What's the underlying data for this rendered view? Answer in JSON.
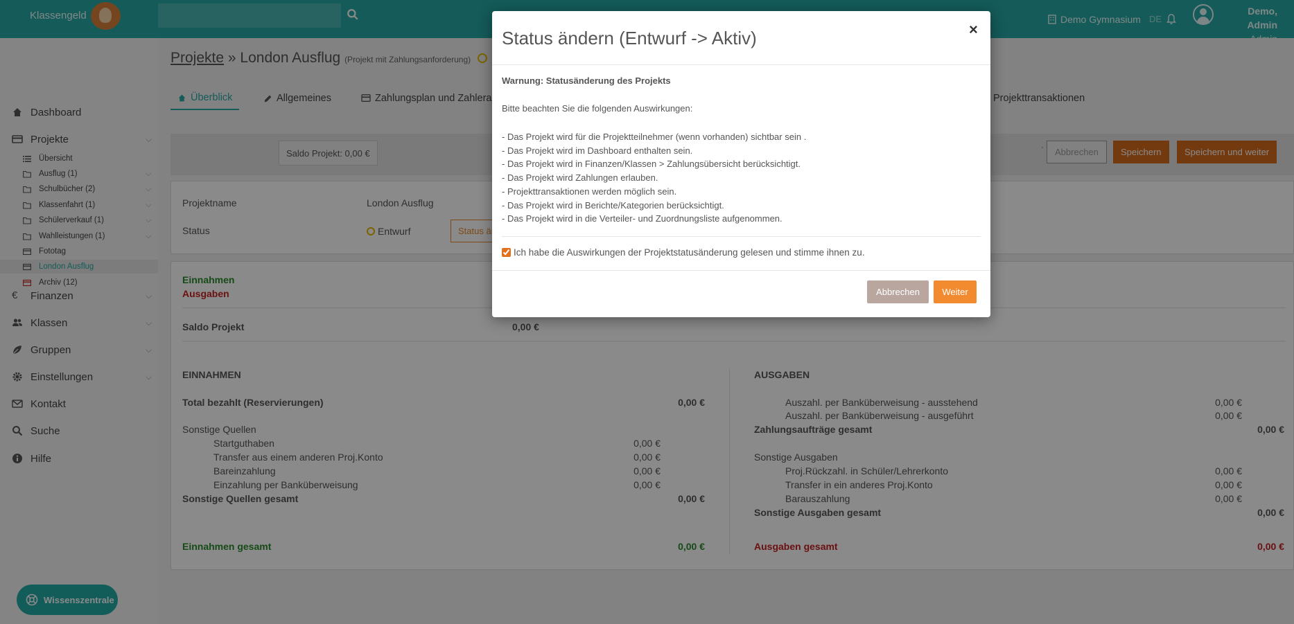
{
  "app": {
    "logo_text": "Klassengeld",
    "school": "Demo Gymnasium",
    "language": "DE",
    "user_name": "Demo, Admin",
    "user_role": "Admin Schule"
  },
  "sidebar": {
    "items": [
      {
        "label": "Dashboard",
        "icon": "home-icon",
        "chevron": false
      },
      {
        "label": "Projekte",
        "icon": "card-icon",
        "chevron": true
      },
      {
        "label": "Finanzen",
        "icon": "euro-icon",
        "chevron": true
      },
      {
        "label": "Klassen",
        "icon": "users-icon",
        "chevron": true
      },
      {
        "label": "Gruppen",
        "icon": "leaf-icon",
        "chevron": true
      },
      {
        "label": "Einstellungen",
        "icon": "gear-icon",
        "chevron": true
      },
      {
        "label": "Kontakt",
        "icon": "mail-icon",
        "chevron": false
      },
      {
        "label": "Suche",
        "icon": "search-icon",
        "chevron": false
      },
      {
        "label": "Hilfe",
        "icon": "info-icon",
        "chevron": false
      }
    ],
    "project_items": [
      {
        "label": "Übersicht",
        "icon": "list-icon"
      },
      {
        "label": "Ausflug (1)",
        "icon": "folder-icon"
      },
      {
        "label": "Schulbücher (2)",
        "icon": "folder-icon"
      },
      {
        "label": "Klassenfahrt (1)",
        "icon": "folder-icon"
      },
      {
        "label": "Schülerverkauf (1)",
        "icon": "folder-icon"
      },
      {
        "label": "Wahlleistungen (1)",
        "icon": "folder-icon"
      },
      {
        "label": "Fototag",
        "icon": "card-icon"
      },
      {
        "label": "London Ausflug",
        "icon": "card-icon"
      },
      {
        "label": "Archiv (12)",
        "icon": "archive-icon"
      }
    ],
    "help_button": "Wissenszentrale"
  },
  "page": {
    "breadcrumb_link": "Projekte",
    "breadcrumb_sep": "»",
    "project_name": "London Ausflug",
    "project_type": "(Projekt mit Zahlungsanforderung)",
    "tabs": [
      {
        "label": "Überblick",
        "icon": "home-icon"
      },
      {
        "label": "Allgemeines",
        "icon": "pencil-icon"
      },
      {
        "label": "Zahlungsplan und Zahleraus",
        "icon": "card-icon"
      },
      {
        "label": "Projekttransaktionen",
        "icon": ""
      }
    ],
    "saldo_badge": "Saldo Projekt: 0,00 €",
    "dot": "·",
    "btn_abbrechen": "Abbrechen",
    "btn_speichern": "Speichern",
    "btn_speichern_weiter": "Speichern und weiter",
    "projektname_label": "Projektname",
    "projektname_value": "London Ausflug",
    "status_label": "Status",
    "status_value": "Entwurf",
    "status_button": "Status änd"
  },
  "finance": {
    "einnahmen": "Einnahmen",
    "ausgaben": "Ausgaben",
    "saldo_projekt_label": "Saldo Projekt",
    "saldo_projekt_value": "0,00 €",
    "left": {
      "heading": "EINNAHMEN",
      "total_label": "Total bezahlt (Reservierungen)",
      "total_value": "0,00 €",
      "sonstige_label": "Sonstige Quellen",
      "rows": [
        {
          "label": "Startguthaben",
          "value": "0,00 €"
        },
        {
          "label": "Transfer aus einem anderen Proj.Konto",
          "value": "0,00 €"
        },
        {
          "label": "Bareinzahlung",
          "value": "0,00 €"
        },
        {
          "label": "Einzahlung per Banküberweisung",
          "value": "0,00 €"
        }
      ],
      "sonstige_total_label": "Sonstige Quellen gesamt",
      "sonstige_total_value": "0,00 €",
      "gesamt_label": "Einnahmen gesamt",
      "gesamt_value": "0,00 €"
    },
    "right": {
      "heading": "AUSGABEN",
      "rows_top": [
        {
          "label": "Auszahl. per Banküberweisung - ausstehend",
          "value": "0,00 €"
        },
        {
          "label": "Auszahl. per Banküberweisung - ausgeführt",
          "value": "0,00 €"
        }
      ],
      "zahlung_total_label": "Zahlungsaufträge gesamt",
      "zahlung_total_value": "0,00 €",
      "sonstige_label": "Sonstige Ausgaben",
      "rows": [
        {
          "label": "Proj.Rückzahl. in Schüler/Lehrerkonto",
          "value": "0,00 €"
        },
        {
          "label": "Transfer in ein anderes Proj.Konto",
          "value": "0,00 €"
        },
        {
          "label": "Barauszahlung",
          "value": "0,00 €"
        }
      ],
      "sonstige_total_label": "Sonstige Ausgaben gesamt",
      "sonstige_total_value": "0,00 €",
      "gesamt_label": "Ausgaben gesamt",
      "gesamt_value": "0,00 €"
    }
  },
  "modal": {
    "title": "Status ändern (Entwurf -> Aktiv)",
    "close": "×",
    "warning": "Warnung: Statusänderung des Projekts",
    "intro": "Bitte beachten Sie die folgenden Auswirkungen:",
    "effects": [
      "- Das Projekt wird für die Projektteilnehmer (wenn vorhanden) sichtbar sein .",
      "- Das Projekt wird im Dashboard enthalten sein.",
      "- Das Projekt wird in Finanzen/Klassen > Zahlungsübersicht berücksichtigt.",
      "- Das Projekt wird Zahlungen erlauben.",
      "- Projekttransaktionen werden möglich sein.",
      "- Das Projekt wird in Berichte/Kategorien berücksichtigt.",
      "- Das Projekt wird in die Verteiler- und Zuordnungsliste aufgenommen."
    ],
    "checkbox_label": "Ich habe die Auswirkungen der Projektstatusänderung gelesen und stimme ihnen zu.",
    "checkbox_checked": true,
    "btn_cancel": "Abbrechen",
    "btn_next": "Weiter"
  }
}
